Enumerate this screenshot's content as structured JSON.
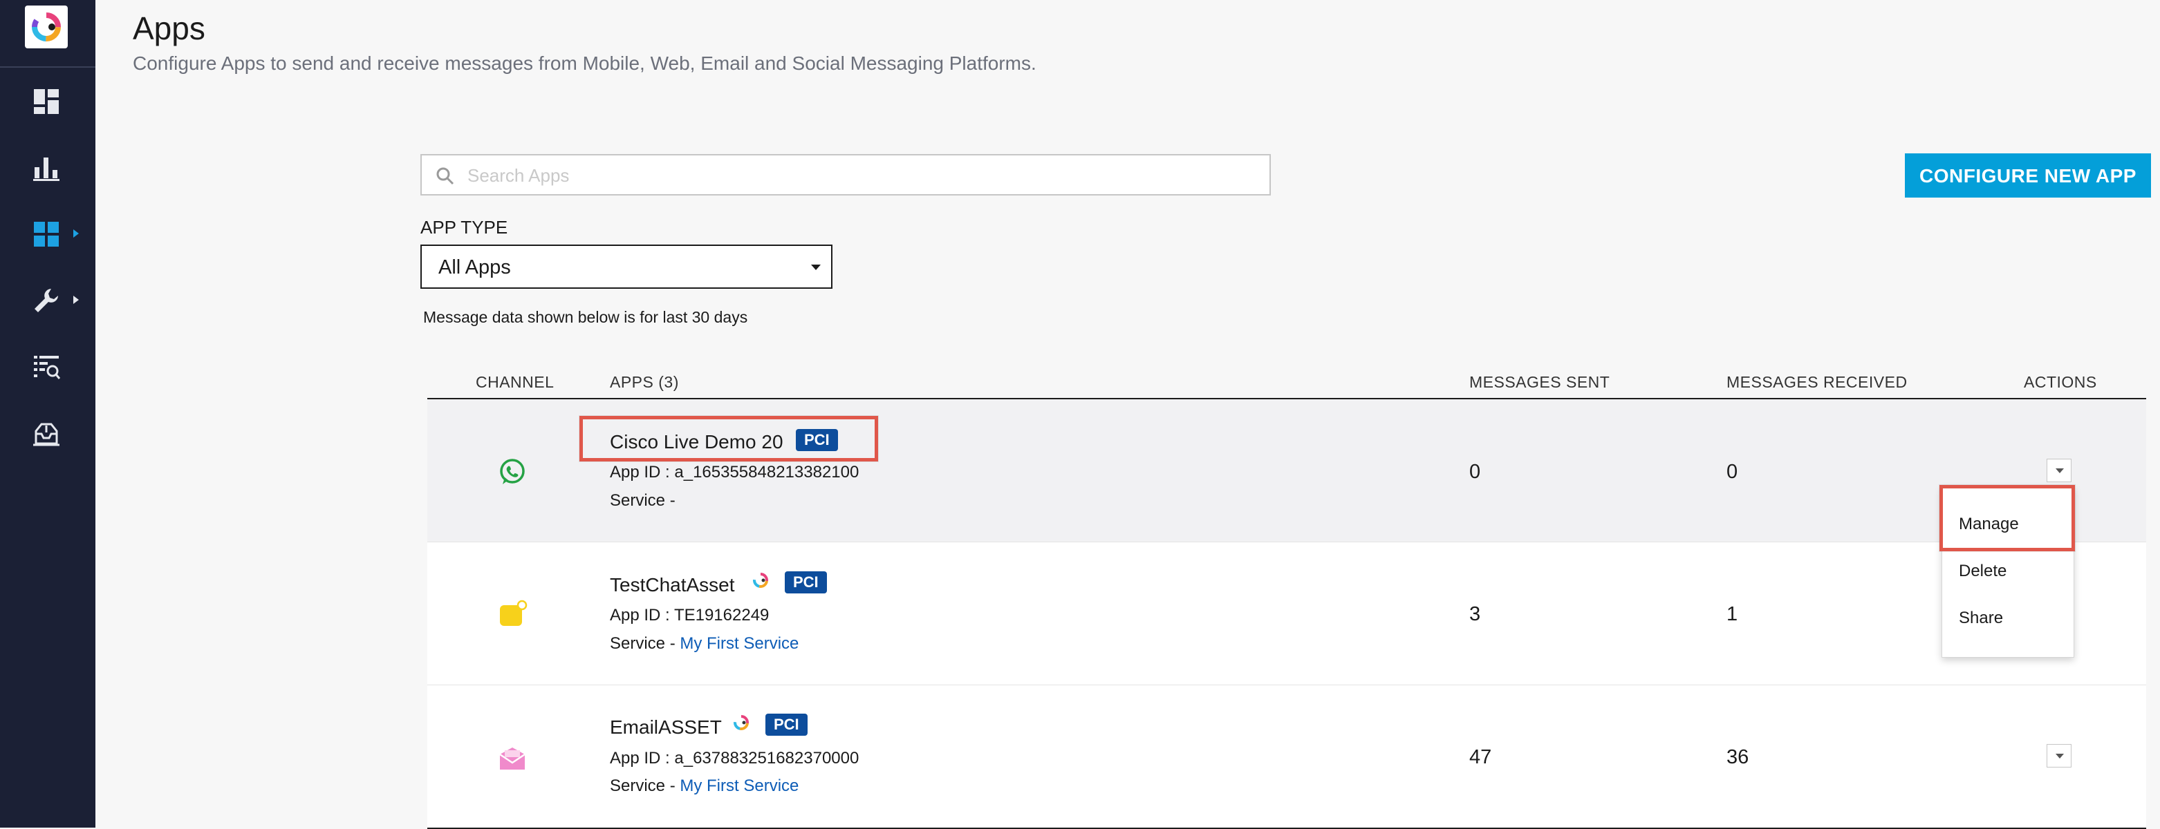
{
  "header": {
    "title": "Apps",
    "subtitle": "Configure Apps to send and receive messages from Mobile, Web, Email and Social Messaging Platforms."
  },
  "sidebar": {
    "items": [
      {
        "icon": "dashboard-icon"
      },
      {
        "icon": "bar-chart-icon"
      },
      {
        "icon": "apps-grid-icon",
        "active": true,
        "has_submenu": true
      },
      {
        "icon": "wrench-icon",
        "has_submenu": true
      },
      {
        "icon": "list-search-icon"
      },
      {
        "icon": "inbox-icon"
      }
    ]
  },
  "toolbar": {
    "search_placeholder": "Search Apps",
    "configure_button": "CONFIGURE NEW APP"
  },
  "filter": {
    "label": "APP TYPE",
    "selected": "All Apps"
  },
  "note": "Message data shown below is for last 30 days",
  "table": {
    "headers": {
      "channel": "CHANNEL",
      "apps": "APPS (3)",
      "sent": "MESSAGES SENT",
      "received": "MESSAGES RECEIVED",
      "actions": "ACTIONS"
    },
    "rows": [
      {
        "channel_icon": "whatsapp-icon",
        "name": "Cisco Live Demo 20",
        "badge": "PCI",
        "app_id": "App ID : a_165355848213382100",
        "service_prefix": "Service -",
        "service_link": "",
        "sent": "0",
        "received": "0"
      },
      {
        "channel_icon": "chat-icon",
        "name": "TestChatAsset",
        "badge": "PCI",
        "app_id": "App ID : TE19162249",
        "service_prefix": "Service - ",
        "service_link": "My First Service",
        "sent": "3",
        "received": "1"
      },
      {
        "channel_icon": "email-icon",
        "name": "EmailASSET",
        "badge": "PCI",
        "app_id": "App ID : a_637883251682370000",
        "service_prefix": "Service - ",
        "service_link": "My First Service",
        "sent": "47",
        "received": "36"
      }
    ]
  },
  "actions_menu": {
    "items": [
      "Manage",
      "Delete",
      "Share"
    ]
  },
  "colors": {
    "sidebar": "#1b2035",
    "accent": "#049fd9",
    "badge": "#0d4d9c",
    "highlight": "#e0574a",
    "link": "#0d5cb6"
  }
}
